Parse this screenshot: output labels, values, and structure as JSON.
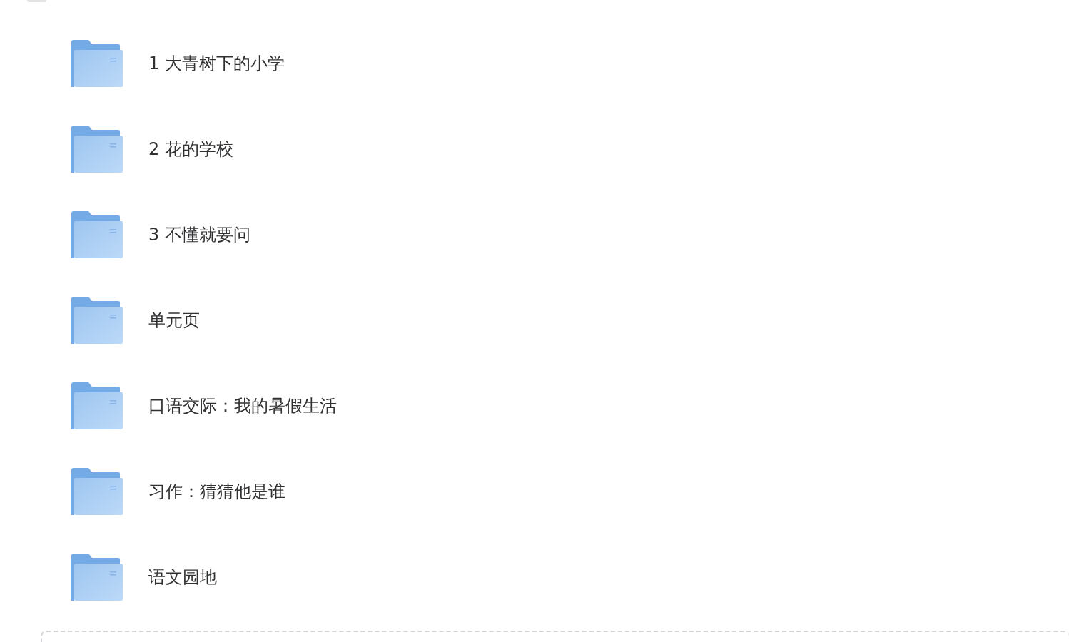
{
  "folders": [
    {
      "name": "1 大青树下的小学"
    },
    {
      "name": "2 花的学校"
    },
    {
      "name": "3 不懂就要问"
    },
    {
      "name": "单元页"
    },
    {
      "name": "口语交际：我的暑假生活"
    },
    {
      "name": "习作：猜猜他是谁"
    },
    {
      "name": "语文园地"
    }
  ]
}
